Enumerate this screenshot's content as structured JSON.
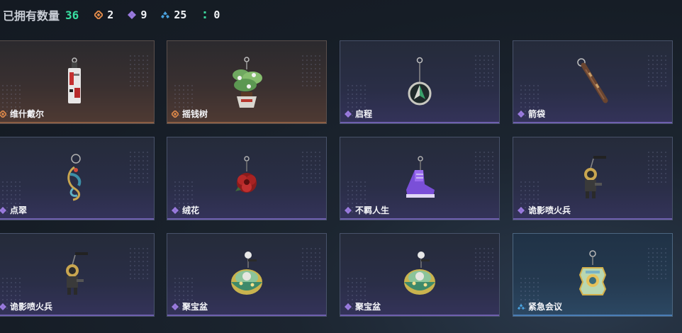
{
  "header": {
    "owned_label": "已拥有数量",
    "owned_total": "36",
    "stats": [
      {
        "icon": "orange-gem-icon",
        "color": "#e08a4a",
        "value": "2"
      },
      {
        "icon": "purple-gem-icon",
        "color": "#9b7be0",
        "value": "9"
      },
      {
        "icon": "blue-gem-icon",
        "color": "#4aa3e0",
        "value": "25"
      },
      {
        "icon": "green-gem-icon",
        "color": "#3bd39a",
        "value": "0"
      }
    ]
  },
  "cards": [
    {
      "name": "维什戴尔",
      "rarity": "orange",
      "icon": "hanging-tag-charm-icon"
    },
    {
      "name": "摇钱树",
      "rarity": "orange",
      "icon": "money-tree-charm-icon"
    },
    {
      "name": "启程",
      "rarity": "purple",
      "icon": "compass-pendant-charm-icon"
    },
    {
      "name": "箭袋",
      "rarity": "purple",
      "icon": "quiver-charm-icon"
    },
    {
      "name": "点翠",
      "rarity": "purple",
      "icon": "phoenix-charm-icon"
    },
    {
      "name": "绒花",
      "rarity": "purple",
      "icon": "red-flower-charm-icon"
    },
    {
      "name": "不羁人生",
      "rarity": "purple",
      "icon": "sneaker-charm-icon"
    },
    {
      "name": "诡影喷火兵",
      "rarity": "purple",
      "icon": "flamethrower-soldier-charm-icon"
    },
    {
      "name": "诡影喷火兵",
      "rarity": "purple",
      "icon": "flamethrower-soldier-charm-icon"
    },
    {
      "name": "聚宝盆",
      "rarity": "purple",
      "icon": "treasure-bowl-charm-icon"
    },
    {
      "name": "聚宝盆",
      "rarity": "purple",
      "icon": "treasure-bowl-charm-icon"
    },
    {
      "name": "紧急会议",
      "rarity": "blue",
      "icon": "badge-charm-icon"
    }
  ]
}
